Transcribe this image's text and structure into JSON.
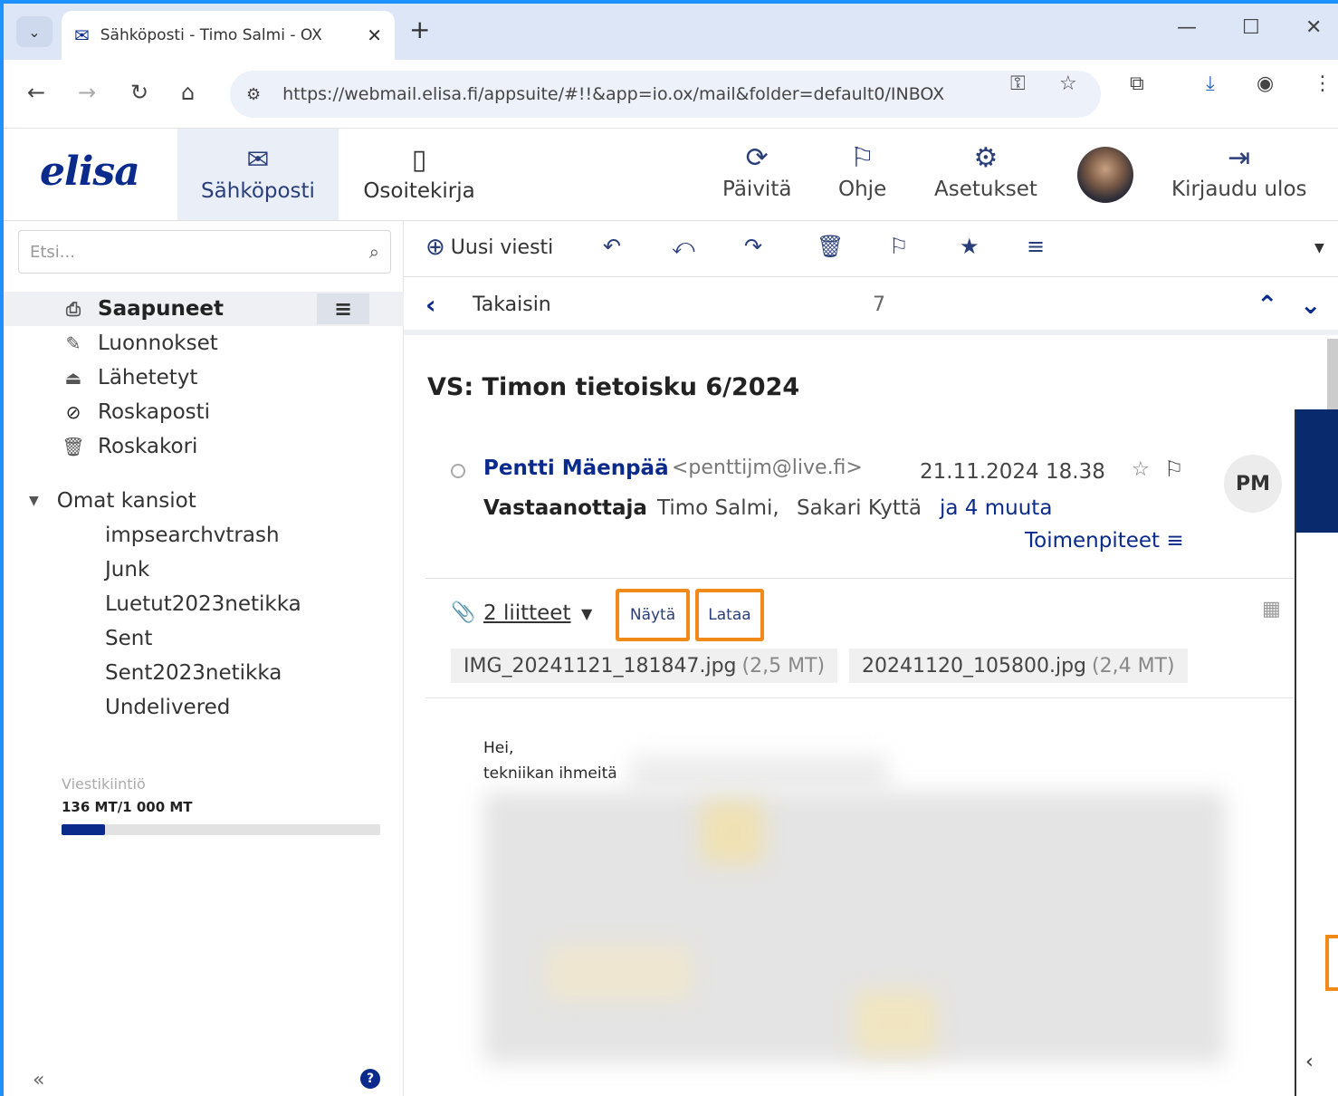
{
  "browser": {
    "tab_title": "Sähköposti - Timo Salmi - OX A",
    "url": "https://webmail.elisa.fi/appsuite/#!!&app=io.ox/mail&folder=default0/INBOX"
  },
  "app": {
    "logo": "elisa",
    "nav": {
      "mail": "Sähköposti",
      "contacts": "Osoitekirja"
    },
    "header_buttons": {
      "refresh": "Päivitä",
      "help": "Ohje",
      "settings": "Asetukset",
      "logout": "Kirjaudu ulos"
    }
  },
  "sidebar": {
    "search_placeholder": "Etsi...",
    "folders": [
      {
        "label": "Saapuneet",
        "icon": "inbox-icon"
      },
      {
        "label": "Luonnokset",
        "icon": "drafts-icon"
      },
      {
        "label": "Lähetetyt",
        "icon": "sent-icon"
      },
      {
        "label": "Roskaposti",
        "icon": "spam-icon"
      },
      {
        "label": "Roskakori",
        "icon": "trash-icon"
      }
    ],
    "my_folders_label": "Omat kansiot",
    "subfolders": [
      "impsearchvtrash",
      "Junk",
      "Luetut2023netikka",
      "Sent",
      "Sent2023netikka",
      "Undelivered"
    ],
    "quota_label": "Viestikiintiö",
    "quota_value": "136 MT/1 000 MT",
    "quota_fraction": 0.136
  },
  "toolbar": {
    "new_message": "Uusi viesti"
  },
  "message_nav": {
    "back": "Takaisin",
    "count": "7"
  },
  "message": {
    "subject": "VS: Timon tietoisku 6/2024",
    "sender_name": "Pentti Mäenpää",
    "sender_email": "<penttijm@live.fi>",
    "date": "21.11.2024 18.38",
    "avatar_initials": "PM",
    "to_label": "Vastaanottaja",
    "to_1": "Timo Salmi,",
    "to_2": "Sakari Kyttä",
    "to_more": "ja 4 muuta",
    "actions": "Toimenpiteet",
    "attachments_link": "2 liitteet",
    "show_button": "Näytä",
    "download_button": "Lataa",
    "attachments": [
      {
        "name": "IMG_20241121_181847.jpg",
        "size": "(2,5 MT)"
      },
      {
        "name": "20241120_105800.jpg",
        "size": "(2,4 MT)"
      }
    ],
    "body_line1": "Hei,",
    "body_line2": "tekniikan ihmeitä"
  },
  "colors": {
    "brand": "#0a2a8c",
    "highlight": "#f08a18",
    "window_border": "#1e90ff"
  }
}
